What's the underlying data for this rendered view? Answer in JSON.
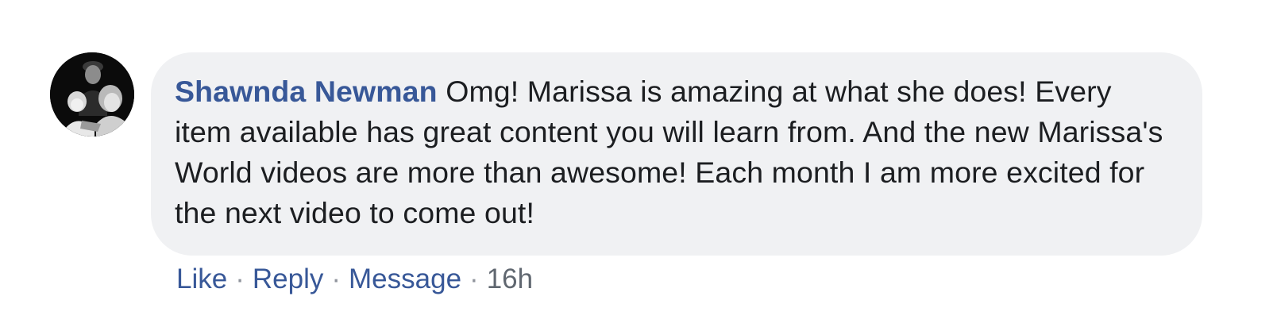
{
  "comment": {
    "author": "Shawnda Newman",
    "text": "Omg! Marissa is amazing at what she does! Every item available has great content you will learn from. And the new Marissa's World videos are more than awesome! Each month I am more excited for the next video to come out!",
    "avatar_icon": "profile-photo"
  },
  "actions": {
    "like": "Like",
    "reply": "Reply",
    "message": "Message",
    "separator": "·",
    "time": "16h"
  },
  "colors": {
    "link": "#385898",
    "bubble": "#f0f1f3",
    "text": "#1c1e21",
    "meta": "#606770"
  }
}
